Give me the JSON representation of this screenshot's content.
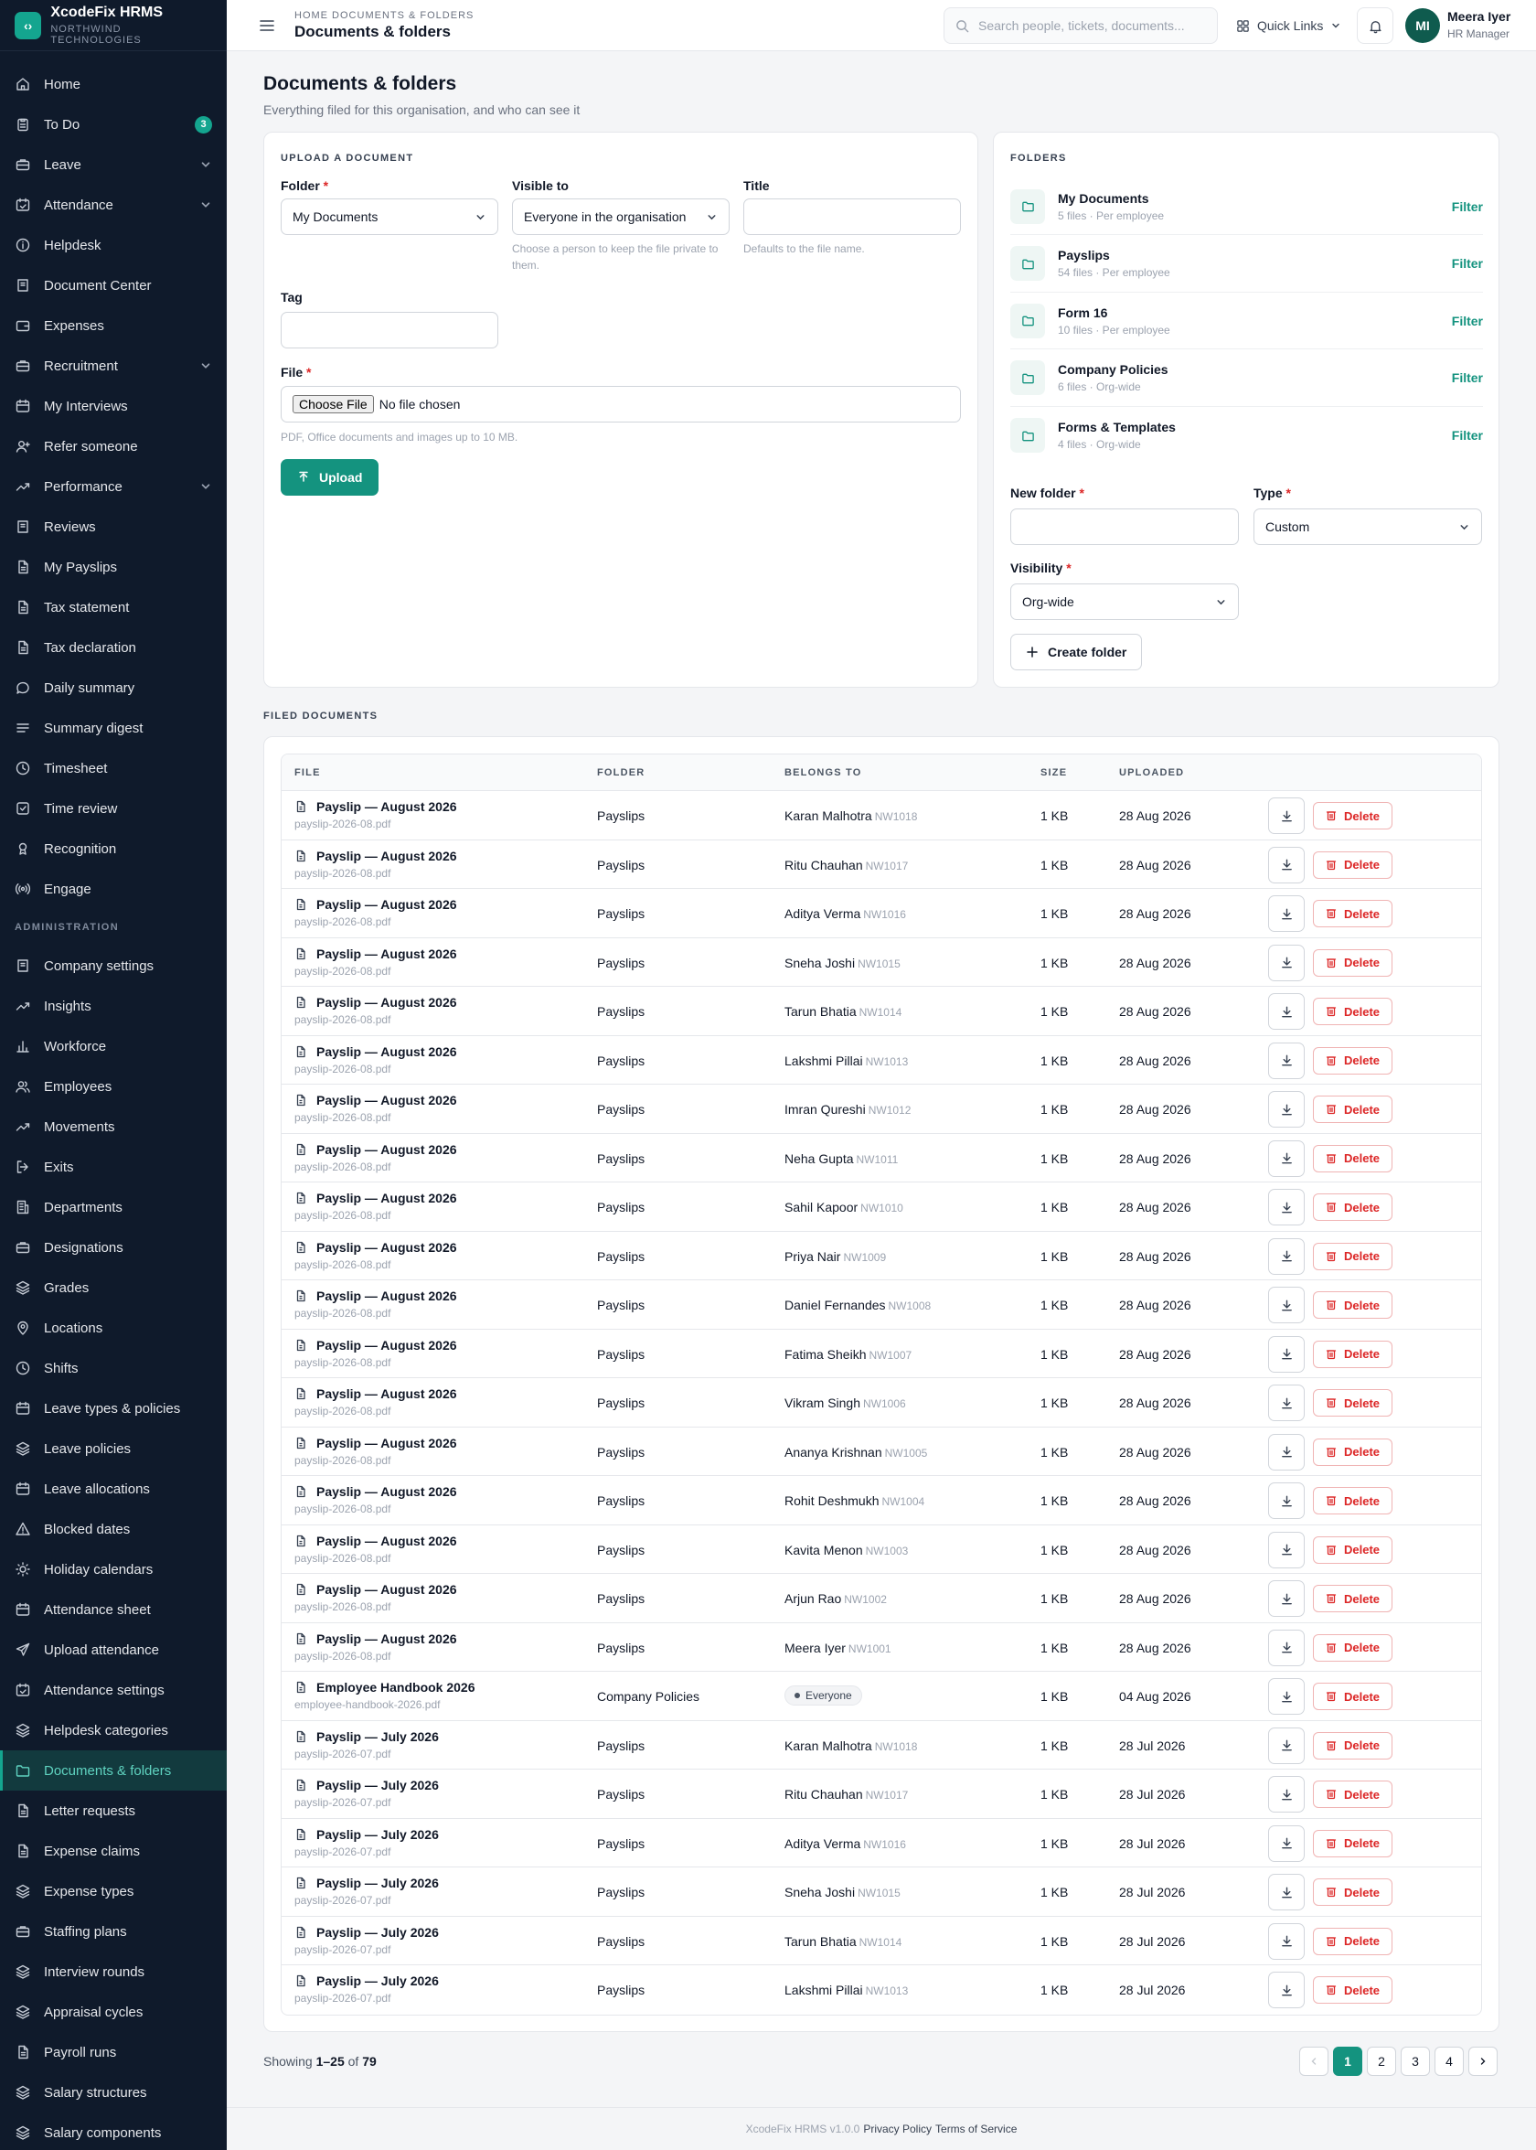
{
  "app": {
    "name": "XcodeFix HRMS",
    "org": "NORTHWIND TECHNOLOGIES",
    "logo_glyph": "‹›"
  },
  "topbar": {
    "breadcrumb": "HOME  DOCUMENTS & FOLDERS",
    "title": "Documents & folders",
    "search_placeholder": "Search people, tickets, documents...",
    "quick_links": "Quick Links",
    "user": {
      "initials": "MI",
      "name": "Meera Iyer",
      "role": "HR Manager"
    }
  },
  "sidebar": {
    "main": [
      {
        "label": "Home",
        "icon": "home-icon"
      },
      {
        "label": "To Do",
        "icon": "clipboard-icon",
        "badge": "3"
      },
      {
        "label": "Leave",
        "icon": "briefcase-icon",
        "chevron": true
      },
      {
        "label": "Attendance",
        "icon": "calendar-check-icon",
        "chevron": true
      },
      {
        "label": "Helpdesk",
        "icon": "info-icon"
      },
      {
        "label": "Document Center",
        "icon": "book-icon"
      },
      {
        "label": "Expenses",
        "icon": "wallet-icon"
      },
      {
        "label": "Recruitment",
        "icon": "briefcase-icon",
        "chevron": true
      },
      {
        "label": "My Interviews",
        "icon": "calendar-icon"
      },
      {
        "label": "Refer someone",
        "icon": "user-plus-icon"
      },
      {
        "label": "Performance",
        "icon": "trend-icon",
        "chevron": true
      },
      {
        "label": "Reviews",
        "icon": "book-icon"
      },
      {
        "label": "My Payslips",
        "icon": "file-icon"
      },
      {
        "label": "Tax statement",
        "icon": "file-icon"
      },
      {
        "label": "Tax declaration",
        "icon": "file-icon"
      },
      {
        "label": "Daily summary",
        "icon": "chat-icon"
      },
      {
        "label": "Summary digest",
        "icon": "list-icon"
      },
      {
        "label": "Timesheet",
        "icon": "clock-icon"
      },
      {
        "label": "Time review",
        "icon": "check-square-icon"
      },
      {
        "label": "Recognition",
        "icon": "award-icon"
      },
      {
        "label": "Engage",
        "icon": "broadcast-icon"
      }
    ],
    "admin_label": "ADMINISTRATION",
    "admin": [
      {
        "label": "Company settings",
        "icon": "book-icon"
      },
      {
        "label": "Insights",
        "icon": "trend-icon"
      },
      {
        "label": "Workforce",
        "icon": "bar-chart-icon"
      },
      {
        "label": "Employees",
        "icon": "users-icon"
      },
      {
        "label": "Movements",
        "icon": "trend-icon"
      },
      {
        "label": "Exits",
        "icon": "logout-icon"
      },
      {
        "label": "Departments",
        "icon": "building-icon"
      },
      {
        "label": "Designations",
        "icon": "briefcase-icon"
      },
      {
        "label": "Grades",
        "icon": "layers-icon"
      },
      {
        "label": "Locations",
        "icon": "pin-icon"
      },
      {
        "label": "Shifts",
        "icon": "clock-icon"
      },
      {
        "label": "Leave types & policies",
        "icon": "calendar-icon"
      },
      {
        "label": "Leave policies",
        "icon": "layers-icon"
      },
      {
        "label": "Leave allocations",
        "icon": "calendar-icon"
      },
      {
        "label": "Blocked dates",
        "icon": "warning-icon"
      },
      {
        "label": "Holiday calendars",
        "icon": "sun-icon"
      },
      {
        "label": "Attendance sheet",
        "icon": "calendar-icon"
      },
      {
        "label": "Upload attendance",
        "icon": "send-icon"
      },
      {
        "label": "Attendance settings",
        "icon": "calendar-check-icon"
      },
      {
        "label": "Helpdesk categories",
        "icon": "layers-icon"
      },
      {
        "label": "Documents & folders",
        "icon": "folder-icon",
        "active": true
      },
      {
        "label": "Letter requests",
        "icon": "file-icon"
      },
      {
        "label": "Expense claims",
        "icon": "file-icon"
      },
      {
        "label": "Expense types",
        "icon": "layers-icon"
      },
      {
        "label": "Staffing plans",
        "icon": "briefcase-icon"
      },
      {
        "label": "Interview rounds",
        "icon": "layers-icon"
      },
      {
        "label": "Appraisal cycles",
        "icon": "layers-icon"
      },
      {
        "label": "Payroll runs",
        "icon": "file-icon"
      },
      {
        "label": "Salary structures",
        "icon": "layers-icon"
      },
      {
        "label": "Salary components",
        "icon": "layers-icon"
      }
    ]
  },
  "page": {
    "title": "Documents & folders",
    "subtitle": "Everything filed for this organisation, and who can see it"
  },
  "upload": {
    "section": "UPLOAD A DOCUMENT",
    "folder_label": "Folder",
    "folder_value": "My Documents",
    "visible_label": "Visible to",
    "visible_value": "Everyone in the organisation",
    "visible_hint": "Choose a person to keep the file private to them.",
    "title_label": "Title",
    "title_value": "",
    "title_hint": "Defaults to the file name.",
    "tag_label": "Tag",
    "tag_value": "",
    "file_label": "File",
    "choose_file": "Choose File",
    "no_file": "No file chosen",
    "file_hint": "PDF, Office documents and images up to 10 MB.",
    "upload_btn": "Upload"
  },
  "folders": {
    "section": "FOLDERS",
    "filter_label": "Filter",
    "items": [
      {
        "name": "My Documents",
        "meta": "5 files · Per employee"
      },
      {
        "name": "Payslips",
        "meta": "54 files · Per employee"
      },
      {
        "name": "Form 16",
        "meta": "10 files · Per employee"
      },
      {
        "name": "Company Policies",
        "meta": "6 files · Org-wide"
      },
      {
        "name": "Forms & Templates",
        "meta": "4 files · Org-wide"
      }
    ],
    "new_folder_label": "New folder",
    "new_folder_value": "",
    "type_label": "Type",
    "type_value": "Custom",
    "visibility_label": "Visibility",
    "visibility_value": "Org-wide",
    "create_btn": "Create folder"
  },
  "filed": {
    "section": "FILED DOCUMENTS",
    "columns": {
      "file": "FILE",
      "folder": "FOLDER",
      "belongs": "BELONGS TO",
      "size": "SIZE",
      "uploaded": "UPLOADED"
    },
    "delete_label": "Delete",
    "rows": [
      {
        "title": "Payslip — August 2026",
        "filename": "payslip-2026-08.pdf",
        "folder": "Payslips",
        "owner": "Karan Malhotra",
        "code": "NW1018",
        "size": "1 KB",
        "date": "28 Aug 2026"
      },
      {
        "title": "Payslip — August 2026",
        "filename": "payslip-2026-08.pdf",
        "folder": "Payslips",
        "owner": "Ritu Chauhan",
        "code": "NW1017",
        "size": "1 KB",
        "date": "28 Aug 2026"
      },
      {
        "title": "Payslip — August 2026",
        "filename": "payslip-2026-08.pdf",
        "folder": "Payslips",
        "owner": "Aditya Verma",
        "code": "NW1016",
        "size": "1 KB",
        "date": "28 Aug 2026"
      },
      {
        "title": "Payslip — August 2026",
        "filename": "payslip-2026-08.pdf",
        "folder": "Payslips",
        "owner": "Sneha Joshi",
        "code": "NW1015",
        "size": "1 KB",
        "date": "28 Aug 2026"
      },
      {
        "title": "Payslip — August 2026",
        "filename": "payslip-2026-08.pdf",
        "folder": "Payslips",
        "owner": "Tarun Bhatia",
        "code": "NW1014",
        "size": "1 KB",
        "date": "28 Aug 2026"
      },
      {
        "title": "Payslip — August 2026",
        "filename": "payslip-2026-08.pdf",
        "folder": "Payslips",
        "owner": "Lakshmi Pillai",
        "code": "NW1013",
        "size": "1 KB",
        "date": "28 Aug 2026"
      },
      {
        "title": "Payslip — August 2026",
        "filename": "payslip-2026-08.pdf",
        "folder": "Payslips",
        "owner": "Imran Qureshi",
        "code": "NW1012",
        "size": "1 KB",
        "date": "28 Aug 2026"
      },
      {
        "title": "Payslip — August 2026",
        "filename": "payslip-2026-08.pdf",
        "folder": "Payslips",
        "owner": "Neha Gupta",
        "code": "NW1011",
        "size": "1 KB",
        "date": "28 Aug 2026"
      },
      {
        "title": "Payslip — August 2026",
        "filename": "payslip-2026-08.pdf",
        "folder": "Payslips",
        "owner": "Sahil Kapoor",
        "code": "NW1010",
        "size": "1 KB",
        "date": "28 Aug 2026"
      },
      {
        "title": "Payslip — August 2026",
        "filename": "payslip-2026-08.pdf",
        "folder": "Payslips",
        "owner": "Priya Nair",
        "code": "NW1009",
        "size": "1 KB",
        "date": "28 Aug 2026"
      },
      {
        "title": "Payslip — August 2026",
        "filename": "payslip-2026-08.pdf",
        "folder": "Payslips",
        "owner": "Daniel Fernandes",
        "code": "NW1008",
        "size": "1 KB",
        "date": "28 Aug 2026"
      },
      {
        "title": "Payslip — August 2026",
        "filename": "payslip-2026-08.pdf",
        "folder": "Payslips",
        "owner": "Fatima Sheikh",
        "code": "NW1007",
        "size": "1 KB",
        "date": "28 Aug 2026"
      },
      {
        "title": "Payslip — August 2026",
        "filename": "payslip-2026-08.pdf",
        "folder": "Payslips",
        "owner": "Vikram Singh",
        "code": "NW1006",
        "size": "1 KB",
        "date": "28 Aug 2026"
      },
      {
        "title": "Payslip — August 2026",
        "filename": "payslip-2026-08.pdf",
        "folder": "Payslips",
        "owner": "Ananya Krishnan",
        "code": "NW1005",
        "size": "1 KB",
        "date": "28 Aug 2026"
      },
      {
        "title": "Payslip — August 2026",
        "filename": "payslip-2026-08.pdf",
        "folder": "Payslips",
        "owner": "Rohit Deshmukh",
        "code": "NW1004",
        "size": "1 KB",
        "date": "28 Aug 2026"
      },
      {
        "title": "Payslip — August 2026",
        "filename": "payslip-2026-08.pdf",
        "folder": "Payslips",
        "owner": "Kavita Menon",
        "code": "NW1003",
        "size": "1 KB",
        "date": "28 Aug 2026"
      },
      {
        "title": "Payslip — August 2026",
        "filename": "payslip-2026-08.pdf",
        "folder": "Payslips",
        "owner": "Arjun Rao",
        "code": "NW1002",
        "size": "1 KB",
        "date": "28 Aug 2026"
      },
      {
        "title": "Payslip — August 2026",
        "filename": "payslip-2026-08.pdf",
        "folder": "Payslips",
        "owner": "Meera Iyer",
        "code": "NW1001",
        "size": "1 KB",
        "date": "28 Aug 2026"
      },
      {
        "title": "Employee Handbook 2026",
        "filename": "employee-handbook-2026.pdf",
        "folder": "Company Policies",
        "owner": "",
        "code": "",
        "badge": "Everyone",
        "size": "1 KB",
        "date": "04 Aug 2026"
      },
      {
        "title": "Payslip — July 2026",
        "filename": "payslip-2026-07.pdf",
        "folder": "Payslips",
        "owner": "Karan Malhotra",
        "code": "NW1018",
        "size": "1 KB",
        "date": "28 Jul 2026"
      },
      {
        "title": "Payslip — July 2026",
        "filename": "payslip-2026-07.pdf",
        "folder": "Payslips",
        "owner": "Ritu Chauhan",
        "code": "NW1017",
        "size": "1 KB",
        "date": "28 Jul 2026"
      },
      {
        "title": "Payslip — July 2026",
        "filename": "payslip-2026-07.pdf",
        "folder": "Payslips",
        "owner": "Aditya Verma",
        "code": "NW1016",
        "size": "1 KB",
        "date": "28 Jul 2026"
      },
      {
        "title": "Payslip — July 2026",
        "filename": "payslip-2026-07.pdf",
        "folder": "Payslips",
        "owner": "Sneha Joshi",
        "code": "NW1015",
        "size": "1 KB",
        "date": "28 Jul 2026"
      },
      {
        "title": "Payslip — July 2026",
        "filename": "payslip-2026-07.pdf",
        "folder": "Payslips",
        "owner": "Tarun Bhatia",
        "code": "NW1014",
        "size": "1 KB",
        "date": "28 Jul 2026"
      },
      {
        "title": "Payslip — July 2026",
        "filename": "payslip-2026-07.pdf",
        "folder": "Payslips",
        "owner": "Lakshmi Pillai",
        "code": "NW1013",
        "size": "1 KB",
        "date": "28 Jul 2026"
      }
    ]
  },
  "pagination": {
    "showing_prefix": "Showing",
    "range": "1–25",
    "of_word": "of",
    "total": "79",
    "pages": [
      "1",
      "2",
      "3",
      "4"
    ],
    "current": "1"
  },
  "footer": {
    "version": "XcodeFix HRMS v1.0.0",
    "privacy": "Privacy Policy",
    "terms": "Terms of Service"
  },
  "colors": {
    "accent": "#14937f",
    "sidebar_bg": "#0f1a2b",
    "danger": "#dc2626"
  }
}
